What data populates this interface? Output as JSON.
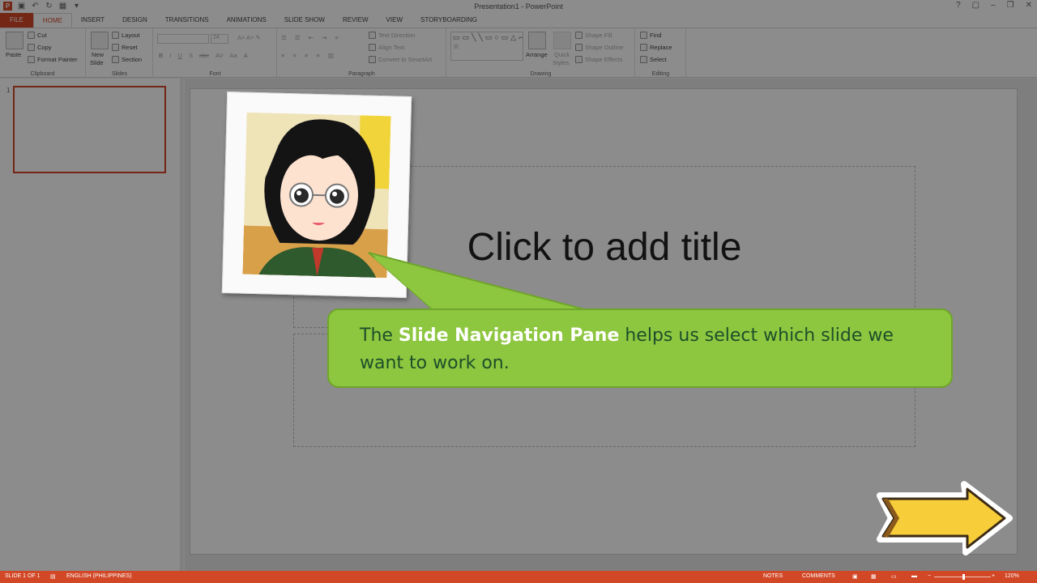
{
  "window": {
    "title": "Presentation1 - PowerPoint",
    "controls": [
      "?",
      "▢",
      "–",
      "❐",
      "✕"
    ]
  },
  "tabs": [
    "FILE",
    "HOME",
    "INSERT",
    "DESIGN",
    "TRANSITIONS",
    "ANIMATIONS",
    "SLIDE SHOW",
    "REVIEW",
    "VIEW",
    "STORYBOARDING"
  ],
  "active_tab": "HOME",
  "ribbon": {
    "clipboard": {
      "label": "Clipboard",
      "paste": "Paste",
      "cut": "Cut",
      "copy": "Copy",
      "format_painter": "Format Painter"
    },
    "slides": {
      "label": "Slides",
      "new_slide": "New",
      "new_slide2": "Slide",
      "layout": "Layout",
      "reset": "Reset",
      "section": "Section"
    },
    "font": {
      "label": "Font",
      "size": "24",
      "bold": "B",
      "italic": "I",
      "underline": "U",
      "strike": "S",
      "abc": "abc",
      "spacing": "AV",
      "case": "Aa",
      "color": "A"
    },
    "paragraph": {
      "label": "Paragraph",
      "text_direction": "Text Direction",
      "align_text": "Align Text",
      "convert_smartart": "Convert to SmartArt"
    },
    "drawing": {
      "label": "Drawing",
      "arrange": "Arrange",
      "quick_styles": "Quick",
      "quick_styles2": "Styles",
      "shape_fill": "Shape Fill",
      "shape_outline": "Shape Outline",
      "shape_effects": "Shape Effects"
    },
    "editing": {
      "label": "Editing",
      "find": "Find",
      "replace": "Replace",
      "select": "Select"
    }
  },
  "slide_pane": {
    "slide_number": "1"
  },
  "slide": {
    "title_placeholder": "Click to add title"
  },
  "callout": {
    "before": "The ",
    "highlight": "Slide Navigation Pane",
    "after_line1": " helps us select which slide we",
    "line2": "want to work on."
  },
  "statusbar": {
    "slide_of": "SLIDE 1 OF 1",
    "language": "ENGLISH (PHILIPPINES)",
    "notes": "NOTES",
    "comments": "COMMENTS",
    "zoom_minus": "−",
    "zoom_plus": "+",
    "zoom": "120%"
  }
}
